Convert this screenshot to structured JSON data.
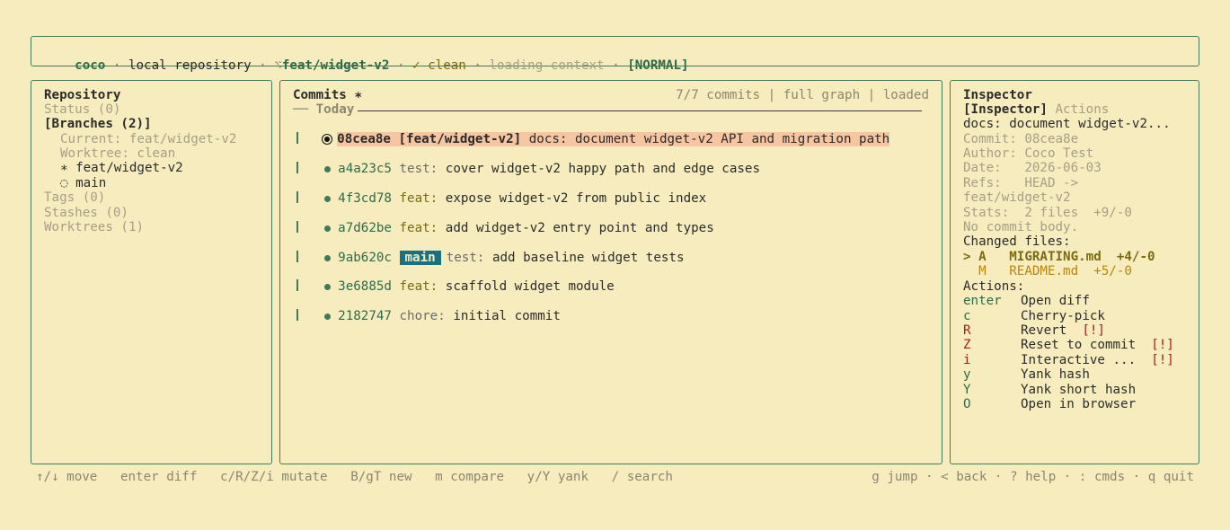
{
  "status": {
    "app": "coco",
    "sep": " · ",
    "repo": "local repository",
    "branch_icon": "⌥",
    "branch": "feat/widget-v2",
    "clean": "✓ clean",
    "context": "loading context",
    "mode": "[NORMAL]"
  },
  "repo": {
    "title": "Repository",
    "status": "Status (0)",
    "branches": "[Branches (2)]",
    "current": "Current: feat/widget-v2",
    "worktree": "Worktree: clean",
    "branch_active": "∗ feat/widget-v2",
    "branch_main": "◌ main",
    "tags": "Tags (0)",
    "stashes": "Stashes (0)",
    "worktrees": "Worktrees (1)"
  },
  "commits": {
    "title": "Commits ∗",
    "meta": "7/7 commits | full graph | loaded",
    "today": "── Today",
    "rows": [
      {
        "hash": "08cea8e",
        "ref": "[feat/widget-v2]",
        "type": "",
        "msg": "docs: document widget-v2 API and migration path"
      },
      {
        "hash": "a4a23c5",
        "ref": "",
        "type": "test:",
        "msg": "cover widget-v2 happy path and edge cases"
      },
      {
        "hash": "4f3cd78",
        "ref": "",
        "type": "feat:",
        "msg": "expose widget-v2 from public index"
      },
      {
        "hash": "a7d62be",
        "ref": "",
        "type": "feat:",
        "msg": "add widget-v2 entry point and types"
      },
      {
        "hash": "9ab620c",
        "ref": "main",
        "type": "test:",
        "msg": "add baseline widget tests"
      },
      {
        "hash": "3e6885d",
        "ref": "",
        "type": "feat:",
        "msg": "scaffold widget module"
      },
      {
        "hash": "2182747",
        "ref": "",
        "type": "chore:",
        "msg": "initial commit"
      }
    ]
  },
  "inspector": {
    "title": "Inspector",
    "tab_active": "[Inspector]",
    "tab_other": "Actions",
    "subject": "docs: document widget-v2...",
    "commit": "Commit: 08cea8e",
    "author": "Author: Coco Test",
    "date": "Date:   2026-06-03",
    "refs": "Refs:   HEAD ->",
    "refs2": "feat/widget-v2",
    "stats": "Stats:  2 files  +9/-0",
    "body": "No commit body.",
    "changed_label": "Changed files:",
    "file1": "> A   MIGRATING.md  +4/-0",
    "file2": "  M   README.md  +5/-0",
    "actions_label": "Actions:",
    "actions": [
      {
        "key": "enter",
        "label": "Open diff",
        "warn": ""
      },
      {
        "key": "c",
        "label": "Cherry-pick",
        "warn": ""
      },
      {
        "key": "R",
        "label": "Revert",
        "warn": "[!]"
      },
      {
        "key": "Z",
        "label": "Reset to commit",
        "warn": "[!]"
      },
      {
        "key": "i",
        "label": "Interactive ...",
        "warn": "[!]"
      },
      {
        "key": "y",
        "label": "Yank hash",
        "warn": ""
      },
      {
        "key": "Y",
        "label": "Yank short hash",
        "warn": ""
      },
      {
        "key": "O",
        "label": "Open in browser",
        "warn": ""
      }
    ]
  },
  "footer": {
    "left": "↑/↓ move   enter diff   c/R/Z/i mutate   B/gT new   m compare   y/Y yank   / search",
    "right": "g jump · < back · ? help · : cmds · q quit"
  },
  "colors": {
    "accent": "#3f7a5a",
    "background": "#f7ecbe",
    "highlight": "#f6c6a2",
    "main_badge": "#1a6f80"
  }
}
